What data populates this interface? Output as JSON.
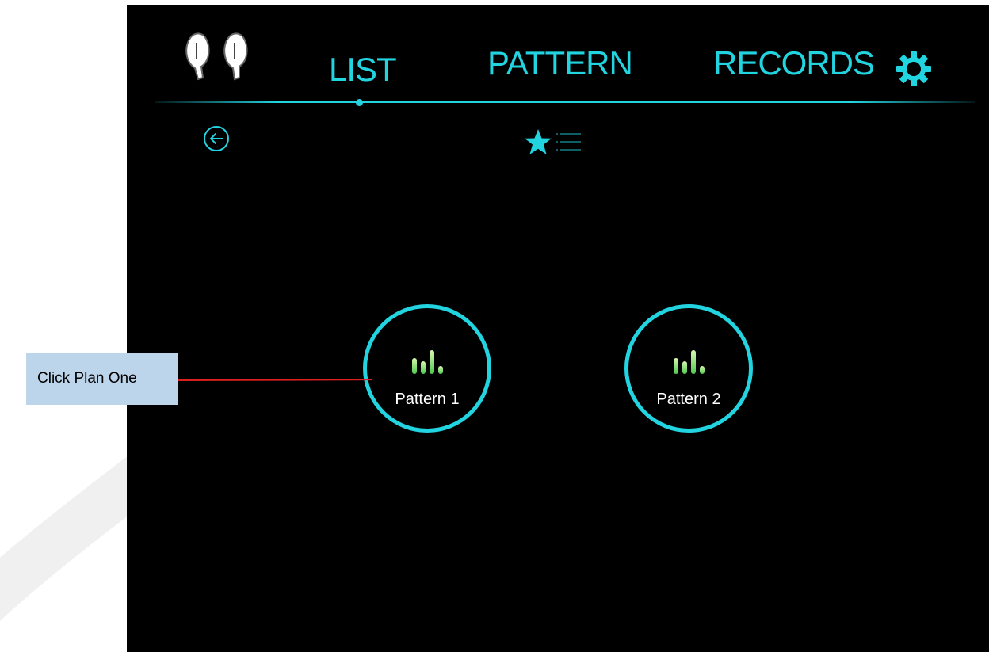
{
  "nav": {
    "tabs": [
      {
        "label": "LIST"
      },
      {
        "label": "PATTERN"
      },
      {
        "label": "RECORDS"
      }
    ],
    "active_tab": "LIST"
  },
  "icons": {
    "devices": "earbuds-icon",
    "settings": "gear-icon",
    "back": "back-arrow-icon",
    "favorites": "star-icon",
    "list": "list-icon"
  },
  "patterns": [
    {
      "label": "Pattern 1",
      "icon": "bars-icon"
    },
    {
      "label": "Pattern 2",
      "icon": "bars-icon"
    }
  ],
  "annotation": {
    "callout_text": "Click Plan One"
  },
  "colors": {
    "accent": "#22d3e0",
    "background": "#000000",
    "callout_bg": "#bdd5ea",
    "callout_line": "#e02020",
    "bar_light": "#d9f7b0",
    "bar_green": "#4ec84e"
  }
}
